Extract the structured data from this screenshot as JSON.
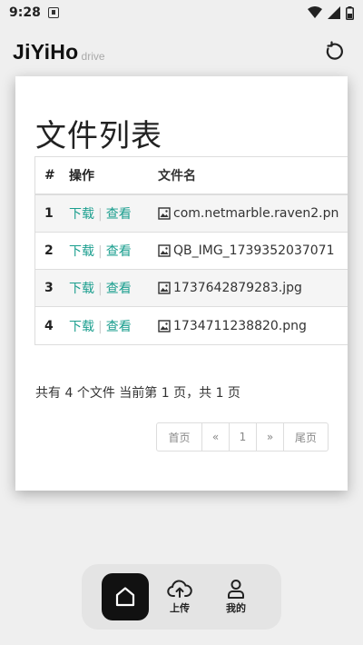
{
  "status": {
    "time": "9:28"
  },
  "header": {
    "brand": "JiYiHo",
    "brand_sub": "drive"
  },
  "card": {
    "title": "文件列表",
    "columns": {
      "num": "#",
      "op": "操作",
      "name": "文件名"
    },
    "rows": [
      {
        "num": "1",
        "download": "下载",
        "view": "查看",
        "name": "com.netmarble.raven2.pn"
      },
      {
        "num": "2",
        "download": "下载",
        "view": "查看",
        "name": "QB_IMG_1739352037071"
      },
      {
        "num": "3",
        "download": "下载",
        "view": "查看",
        "name": "1737642879283.jpg"
      },
      {
        "num": "4",
        "download": "下载",
        "view": "查看",
        "name": "1734711238820.png"
      }
    ],
    "summary": {
      "prefix": "共有 ",
      "count": "4",
      "mid": " 个文件  当前第 ",
      "page": "1",
      "mid2": " 页，共 ",
      "total": "1",
      "suffix": " 页"
    },
    "pagination": {
      "first": "首页",
      "prev": "«",
      "current": "1",
      "next": "»",
      "last": "尾页"
    }
  },
  "nav": {
    "upload": "上传",
    "mine": "我的"
  },
  "colors": {
    "link": "#1a9e8e",
    "nav_active": "#111111"
  }
}
